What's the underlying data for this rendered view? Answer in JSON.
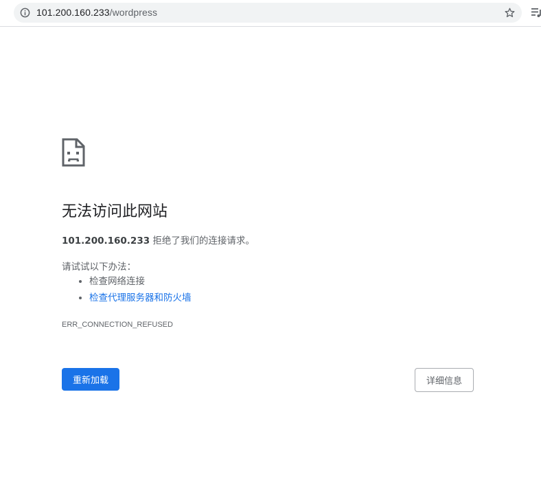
{
  "toolbar": {
    "url_host": "101.200.160.233",
    "url_path": "/wordpress",
    "icons": [
      "reload-icon",
      "info-icon",
      "star-icon",
      "reading-list-icon"
    ]
  },
  "error_page": {
    "title": "无法访问此网站",
    "host": "101.200.160.233",
    "description_suffix": " 拒绝了我们的连接请求。",
    "try_label": "请试试以下办法：",
    "suggestions": [
      {
        "label": "检查网络连接",
        "link": false
      },
      {
        "label": "检查代理服务器和防火墙",
        "link": true
      }
    ],
    "error_code": "ERR_CONNECTION_REFUSED",
    "reload_button": "重新加载",
    "details_button": "详细信息"
  },
  "colors": {
    "accent": "#1a73e8",
    "text_primary": "#202124",
    "text_secondary": "#5f6368",
    "omnibox_bg": "#f1f3f4"
  }
}
